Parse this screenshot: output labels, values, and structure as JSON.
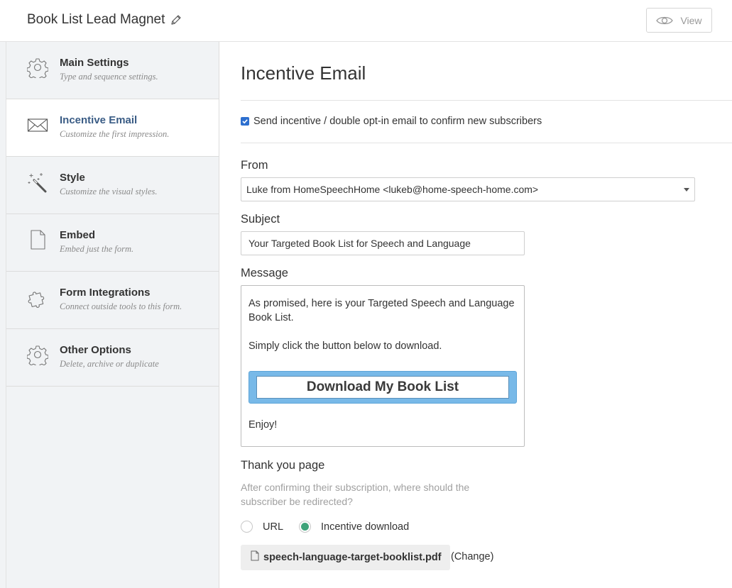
{
  "header": {
    "title": "Book List Lead Magnet",
    "view_label": "View"
  },
  "sidebar": {
    "items": [
      {
        "label": "Main Settings",
        "sub": "Type and sequence settings.",
        "icon": "gear-icon"
      },
      {
        "label": "Incentive Email",
        "sub": "Customize the first impression.",
        "icon": "envelope-icon",
        "active": true
      },
      {
        "label": "Style",
        "sub": "Customize the visual styles.",
        "icon": "magic-wand-icon"
      },
      {
        "label": "Embed",
        "sub": "Embed just the form.",
        "icon": "document-icon"
      },
      {
        "label": "Form Integrations",
        "sub": "Connect outside tools to this form.",
        "icon": "puzzle-icon"
      },
      {
        "label": "Other Options",
        "sub": "Delete, archive or duplicate",
        "icon": "gear-icon"
      }
    ]
  },
  "main": {
    "title": "Incentive Email",
    "send_incentive_label": "Send incentive / double opt-in email to confirm new subscribers",
    "send_incentive_checked": true,
    "from_label": "From",
    "from_value": "Luke from HomeSpeechHome <lukeb@home-speech-home.com>",
    "subject_label": "Subject",
    "subject_value": "Your Targeted Book List for Speech and Language",
    "message_label": "Message",
    "message": {
      "para1": "As promised, here is your Targeted Speech and Language Book List.",
      "para2": "Simply click the button below to download.",
      "button": "Download My Book List",
      "para3": "Enjoy!"
    },
    "thank_you_label": "Thank you page",
    "thank_you_help": "After confirming their subscription, where should the subscriber be redirected?",
    "radio_url": "URL",
    "radio_incentive": "Incentive download",
    "selected_redirect": "Incentive download",
    "file_name": "speech-language-target-booklist.pdf",
    "change_label": "(Change)"
  },
  "colors": {
    "accent": "#3a5c85",
    "checkbox": "#2d6fcf",
    "radio_selected": "#3fa37a",
    "button_bg": "#78b9e8"
  }
}
